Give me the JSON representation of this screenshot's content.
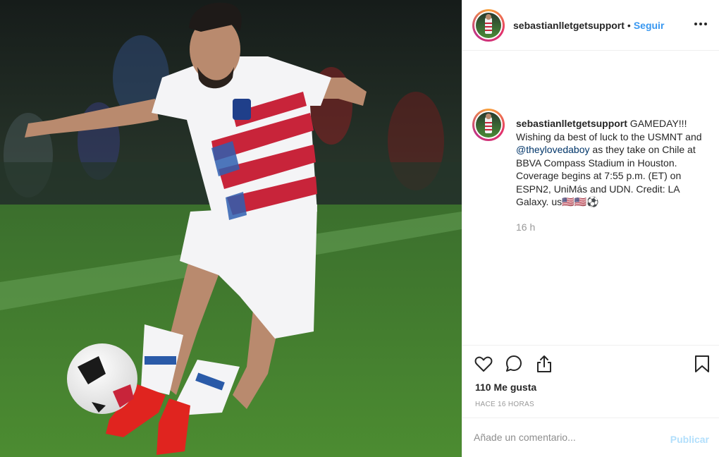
{
  "post": {
    "username": "sebastianlletgetsupport",
    "separator": "•",
    "follow_label": "Seguir",
    "more_icon": "more-options-icon"
  },
  "caption": {
    "username": "sebastianlletgetsupport",
    "text_before_mention": " GAMEDAY!!! Wishing da best of luck to the USMNT and ",
    "mention": "@theylovedaboy",
    "text_after_mention": " as they take on Chile at BBVA Compass Stadium in Houston. Coverage begins at 7:55 p.m. (ET) on ESPN2, UniMás and UDN. Credit: LA Galaxy. us🇺🇸🇺🇸⚽",
    "time": "16 h"
  },
  "actions": {
    "like_icon": "heart-icon",
    "comment_icon": "comment-icon",
    "share_icon": "share-icon",
    "save_icon": "bookmark-icon"
  },
  "stats": {
    "likes": "110 Me gusta",
    "posted_ago": "HACE 16 HORAS"
  },
  "comment": {
    "placeholder": "Añade un comentario...",
    "publish_label": "Publicar"
  },
  "colors": {
    "link": "#3897f0",
    "mention": "#003569",
    "publish_disabled": "#b2dffc",
    "muted": "#999999"
  }
}
